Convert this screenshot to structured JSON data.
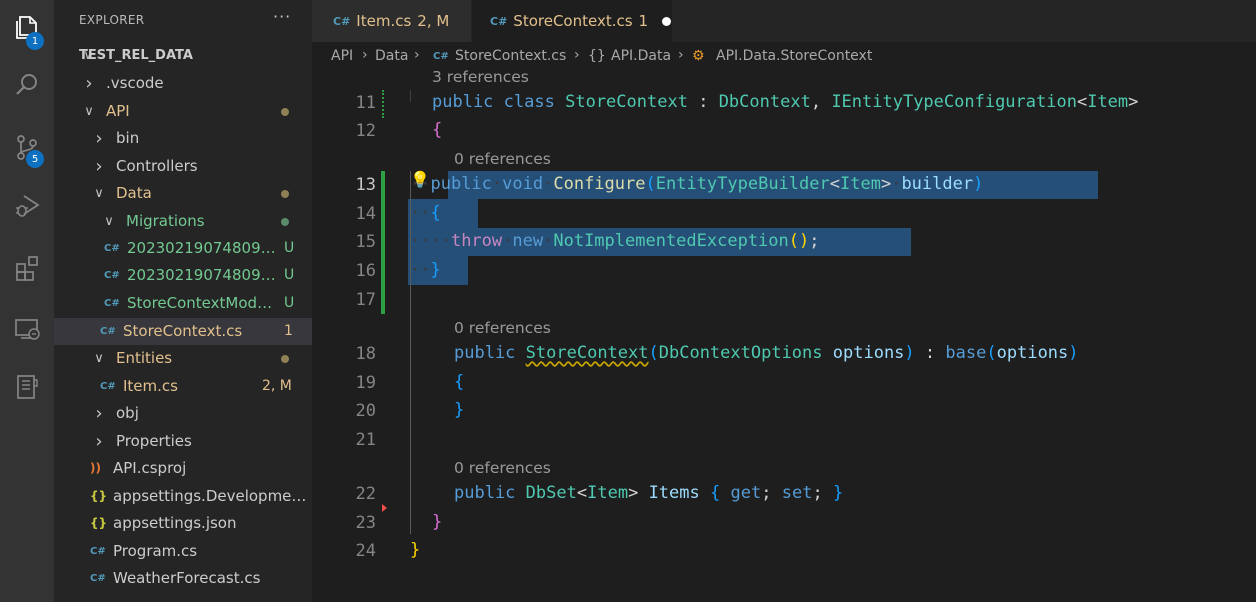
{
  "activity_bar": {
    "items": [
      {
        "name": "explorer",
        "icon": "files-icon",
        "badge": "1"
      },
      {
        "name": "search",
        "icon": "search-icon"
      },
      {
        "name": "source-control",
        "icon": "source-control-icon",
        "badge": "5"
      },
      {
        "name": "run-debug",
        "icon": "run-debug-icon"
      },
      {
        "name": "extensions",
        "icon": "extensions-icon"
      },
      {
        "name": "remote-explorer",
        "icon": "remote-explorer-icon"
      },
      {
        "name": "notebook",
        "icon": "notebook-icon"
      }
    ]
  },
  "explorer": {
    "title": "EXPLORER",
    "more_label": "···",
    "tree": [
      {
        "label": "TEST_REL_DATA",
        "kind": "root",
        "chevron": "down",
        "depth": 0
      },
      {
        "label": ".vscode",
        "kind": "folder",
        "chevron": "right",
        "depth": 1
      },
      {
        "label": "API",
        "kind": "folder",
        "chevron": "down",
        "depth": 1,
        "dot": "modified"
      },
      {
        "label": "bin",
        "kind": "folder",
        "chevron": "right",
        "depth": 2
      },
      {
        "label": "Controllers",
        "kind": "folder",
        "chevron": "right",
        "depth": 2
      },
      {
        "label": "Data",
        "kind": "folder",
        "chevron": "down",
        "depth": 2,
        "dot": "modified"
      },
      {
        "label": "Migrations",
        "kind": "folder",
        "chevron": "down",
        "depth": 3,
        "dot": "untracked"
      },
      {
        "label": "20230219074809_I...",
        "kind": "cs",
        "depth": 4,
        "status": "U"
      },
      {
        "label": "20230219074809_I...",
        "kind": "cs",
        "depth": 4,
        "status": "U"
      },
      {
        "label": "StoreContextMode...",
        "kind": "cs",
        "depth": 4,
        "status": "U"
      },
      {
        "label": "StoreContext.cs",
        "kind": "cs",
        "depth": 3,
        "status": "1",
        "selected": true
      },
      {
        "label": "Entities",
        "kind": "folder",
        "chevron": "down",
        "depth": 2,
        "dot": "modified"
      },
      {
        "label": "Item.cs",
        "kind": "cs",
        "depth": 3,
        "status": "2, M"
      },
      {
        "label": "obj",
        "kind": "folder",
        "chevron": "right",
        "depth": 2
      },
      {
        "label": "Properties",
        "kind": "folder",
        "chevron": "right",
        "depth": 2
      },
      {
        "label": "API.csproj",
        "kind": "rss",
        "depth": 2
      },
      {
        "label": "appsettings.Development.j...",
        "kind": "json",
        "depth": 2
      },
      {
        "label": "appsettings.json",
        "kind": "json",
        "depth": 2
      },
      {
        "label": "Program.cs",
        "kind": "cs",
        "depth": 2
      },
      {
        "label": "WeatherForecast.cs",
        "kind": "cs",
        "depth": 2
      }
    ]
  },
  "tabs": [
    {
      "label": "Item.cs",
      "status": "2, M",
      "active": false
    },
    {
      "label": "StoreContext.cs",
      "status": "1",
      "active": true,
      "dirty": true
    }
  ],
  "breadcrumbs": [
    "API",
    "Data",
    "StoreContext.cs",
    "API.Data",
    "API.Data.StoreContext"
  ],
  "editor": {
    "lens_top": "3 references",
    "lens_configure": "0 references",
    "lens_ctor": "0 references",
    "lens_items": "0 references",
    "line_numbers": [
      "11",
      "12",
      "13",
      "14",
      "15",
      "16",
      "17",
      "18",
      "19",
      "20",
      "21",
      "22",
      "23",
      "24"
    ],
    "current_line": "13",
    "code": {
      "l11": [
        "public",
        "class",
        "StoreContext",
        ":",
        "DbContext",
        ",",
        "IEntityTypeConfiguration",
        "<",
        "Item",
        ">"
      ],
      "l12": [
        "{"
      ],
      "l13": [
        "public",
        "void",
        "Configure",
        "(",
        "EntityTypeBuilder",
        "<",
        "Item",
        ">",
        "builder",
        ")"
      ],
      "l14": [
        "{"
      ],
      "l15": [
        "throw",
        "new",
        "NotImplementedException",
        "(",
        ")",
        ";"
      ],
      "l16": [
        "}"
      ],
      "l18": [
        "public",
        "StoreContext",
        "(",
        "DbContextOptions",
        "options",
        ")",
        ":",
        "base",
        "(",
        "options",
        ")"
      ],
      "l19": [
        "{"
      ],
      "l20": [
        "}"
      ],
      "l22": [
        "public",
        "DbSet",
        "<",
        "Item",
        ">",
        "Items",
        "{",
        "get",
        ";",
        "set",
        ";",
        "}"
      ],
      "l23": [
        "}"
      ],
      "l24": [
        "}"
      ]
    },
    "colors": {
      "keyword": "#569cd6",
      "type": "#4ec9b0",
      "function": "#dcdcaa",
      "parameter": "#9cdcfe",
      "control": "#c586c0",
      "selection": "#264f78",
      "modified_gutter": "#2ea043",
      "untracked": "#73c991",
      "modified": "#e2c08d"
    }
  }
}
